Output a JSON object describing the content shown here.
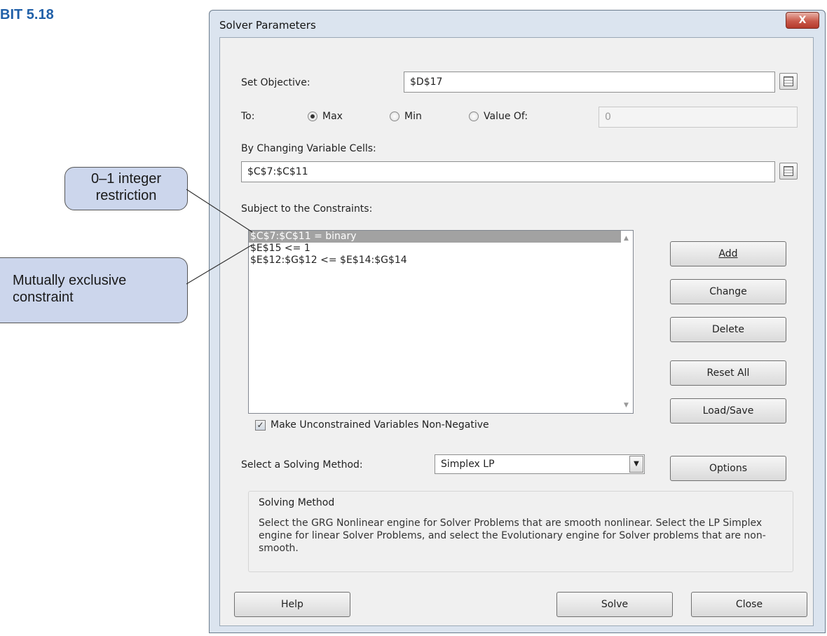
{
  "exhibit_label": "BIT 5.18",
  "callouts": {
    "integer": "0–1 integer restriction",
    "mutual": "Mutually exclusive constraint"
  },
  "window": {
    "title": "Solver Parameters",
    "close_glyph": "X"
  },
  "objective": {
    "label": "Set Objective:",
    "value": "$D$17"
  },
  "to": {
    "label": "To:",
    "options": [
      "Max",
      "Min",
      "Value Of:"
    ],
    "selected": "Max",
    "value_of": "0"
  },
  "changing": {
    "label": "By Changing Variable Cells:",
    "value": "$C$7:$C$11"
  },
  "constraints": {
    "label": "Subject to the Constraints:",
    "items": [
      "$C$7:$C$11 = binary",
      "$E$15 <= 1",
      "$E$12:$G$12 <= $E$14:$G$14"
    ],
    "selected_index": 0
  },
  "buttons": {
    "add": "Add",
    "change": "Change",
    "delete": "Delete",
    "reset_all": "Reset All",
    "load_save": "Load/Save",
    "options": "Options",
    "help": "Help",
    "solve": "Solve",
    "close": "Close"
  },
  "nonneg": {
    "label": "Make Unconstrained Variables Non-Negative",
    "checked": true
  },
  "method": {
    "label": "Select a Solving Method:",
    "value": "Simplex LP"
  },
  "solving_method": {
    "title": "Solving Method",
    "text": "Select the GRG Nonlinear engine for Solver Problems that are smooth nonlinear. Select the LP Simplex engine for linear Solver Problems, and select the Evolutionary engine for Solver problems that are non-smooth."
  }
}
